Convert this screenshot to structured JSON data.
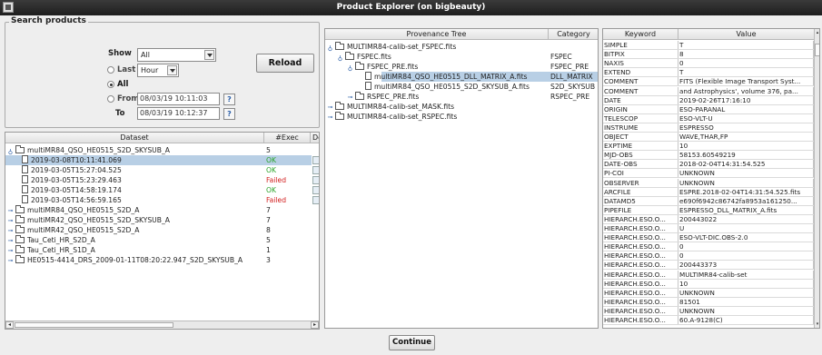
{
  "window": {
    "title": "Product Explorer (on bigbeauty)"
  },
  "search": {
    "legend": "Search products",
    "show_label": "Show",
    "show_value": "All",
    "last_label": "Last",
    "last_value": "Hour",
    "all_label": "All",
    "from_label": "From",
    "from_value": "08/03/19 10:11:03",
    "to_label": "To",
    "to_value": "08/03/19 10:12:37",
    "selected_mode": "All",
    "reload_label": "Reload",
    "picker_glyph": "?"
  },
  "datasets": {
    "headers": [
      "Dataset",
      "#Exec",
      "De"
    ],
    "rows": [
      {
        "label": "multiMR84_QSO_HE0515_S2D_SKYSUB_A",
        "exec": "5",
        "status": "",
        "kind": "group-open"
      },
      {
        "label": "2019-03-08T10:11:41.069",
        "exec": "",
        "status": "OK",
        "kind": "exec",
        "selected": true
      },
      {
        "label": "2019-03-05T15:27:04.525",
        "exec": "",
        "status": "OK",
        "kind": "exec"
      },
      {
        "label": "2019-03-05T15:23:29.463",
        "exec": "",
        "status": "Failed",
        "kind": "exec"
      },
      {
        "label": "2019-03-05T14:58:19.174",
        "exec": "",
        "status": "OK",
        "kind": "exec"
      },
      {
        "label": "2019-03-05T14:56:59.165",
        "exec": "",
        "status": "Failed",
        "kind": "exec"
      },
      {
        "label": "multiMR84_QSO_HE0515_S2D_A",
        "exec": "7",
        "status": "",
        "kind": "group"
      },
      {
        "label": "multiMR42_QSO_HE0515_S2D_SKYSUB_A",
        "exec": "7",
        "status": "",
        "kind": "group"
      },
      {
        "label": "multiMR42_QSO_HE0515_S2D_A",
        "exec": "8",
        "status": "",
        "kind": "group"
      },
      {
        "label": "Tau_Ceti_HR_S2D_A",
        "exec": "5",
        "status": "",
        "kind": "group"
      },
      {
        "label": "Tau_Ceti_HR_S1D_A",
        "exec": "1",
        "status": "",
        "kind": "group"
      },
      {
        "label": "HE0515-4414_DRS_2009-01-11T08:20:22.947_S2D_SKYSUB_A",
        "exec": "3",
        "status": "",
        "kind": "group"
      }
    ]
  },
  "provenance": {
    "headers": [
      "Provenance Tree",
      "Category"
    ],
    "rows": [
      {
        "label": "MULTIMR84-calib-set_FSPEC.fits",
        "category": "",
        "level": 0,
        "icon": "folder",
        "expander": "open"
      },
      {
        "label": "FSPEC.fits",
        "category": "FSPEC",
        "level": 1,
        "icon": "folder",
        "expander": "open"
      },
      {
        "label": "FSPEC_PRE.fits",
        "category": "FSPEC_PRE",
        "level": 2,
        "icon": "folder",
        "expander": "open"
      },
      {
        "label": "multiMR84_QSO_HE0515_DLL_MATRIX_A.fits",
        "category": "DLL_MATRIX",
        "level": 3,
        "icon": "file",
        "expander": "",
        "selected": true
      },
      {
        "label": "multiMR84_QSO_HE0515_S2D_SKYSUB_A.fits",
        "category": "S2D_SKYSUB",
        "level": 3,
        "icon": "file",
        "expander": ""
      },
      {
        "label": "RSPEC_PRE.fits",
        "category": "RSPEC_PRE",
        "level": 2,
        "icon": "folder",
        "expander": "closed"
      },
      {
        "label": "MULTIMR84-calib-set_MASK.fits",
        "category": "",
        "level": 0,
        "icon": "folder",
        "expander": "closed"
      },
      {
        "label": "MULTIMR84-calib-set_RSPEC.fits",
        "category": "",
        "level": 0,
        "icon": "folder",
        "expander": "closed"
      }
    ]
  },
  "header_table": {
    "headers": [
      "Keyword",
      "Value"
    ],
    "rows": [
      [
        "SIMPLE",
        "T"
      ],
      [
        "BITPIX",
        "8"
      ],
      [
        "NAXIS",
        "0"
      ],
      [
        "EXTEND",
        "T"
      ],
      [
        "COMMENT",
        "FITS (Flexible Image Transport Syst..."
      ],
      [
        "COMMENT",
        "and Astrophysics', volume 376, pa..."
      ],
      [
        "DATE",
        "2019-02-26T17:16:10"
      ],
      [
        "ORIGIN",
        "ESO-PARANAL"
      ],
      [
        "TELESCOP",
        "ESO-VLT-U"
      ],
      [
        "INSTRUME",
        "ESPRESSO"
      ],
      [
        "OBJECT",
        "WAVE,THAR,FP"
      ],
      [
        "EXPTIME",
        "10"
      ],
      [
        "MJD-OBS",
        "58153.60549219"
      ],
      [
        "DATE-OBS",
        "2018-02-04T14:31:54.525"
      ],
      [
        "PI-COI",
        "UNKNOWN"
      ],
      [
        "OBSERVER",
        "UNKNOWN"
      ],
      [
        "ARCFILE",
        "ESPRE.2018-02-04T14:31:54.525.fits"
      ],
      [
        "DATAMD5",
        "e690f6942c86742fa8953a161250..."
      ],
      [
        "PIPEFILE",
        "ESPRESSO_DLL_MATRIX_A.fits"
      ],
      [
        "HIERARCH.ESO.O...",
        "200443022"
      ],
      [
        "HIERARCH.ESO.O...",
        "U"
      ],
      [
        "HIERARCH.ESO.O...",
        "ESO-VLT-DIC.OBS-2.0"
      ],
      [
        "HIERARCH.ESO.O...",
        "0"
      ],
      [
        "HIERARCH.ESO.O...",
        "0"
      ],
      [
        "HIERARCH.ESO.O...",
        "200443373"
      ],
      [
        "HIERARCH.ESO.O...",
        "MULTIMR84-calib-set"
      ],
      [
        "HIERARCH.ESO.O...",
        "10"
      ],
      [
        "HIERARCH.ESO.O...",
        "UNKNOWN"
      ],
      [
        "HIERARCH.ESO.O...",
        "81501"
      ],
      [
        "HIERARCH.ESO.O...",
        "UNKNOWN"
      ],
      [
        "HIERARCH.ESO.O...",
        "60.A-9128(C)"
      ]
    ]
  },
  "footer": {
    "continue_label": "Continue"
  },
  "colors": {
    "ok": "#29a329",
    "failed": "#d21f1f",
    "selection": "#b8cfe5",
    "expander": "#2a5ea8"
  }
}
